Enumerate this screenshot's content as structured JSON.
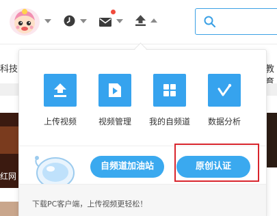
{
  "header": {
    "icons": [
      "avatar",
      "history-clock-icon",
      "mail-icon",
      "upload-icon",
      "search-icon"
    ],
    "accent": "#3aa0e5",
    "notification_color": "#f04a3c"
  },
  "background": {
    "nav_left_fragment": "科技",
    "nav_right_fragment": "教育",
    "thumb_caption_fragment": "红网"
  },
  "upload_menu": {
    "items": [
      {
        "label": "上传视频",
        "icon": "upload-icon"
      },
      {
        "label": "视频管理",
        "icon": "play-icon"
      },
      {
        "label": "我的自频道",
        "icon": "grid-icon"
      },
      {
        "label": "数据分析",
        "icon": "analytics-check-icon"
      }
    ],
    "promo_buttons": {
      "channel_boost": "自频道加油站",
      "original_cert": "原创认证"
    },
    "footer_text": "下载PC客户端，上传视频更轻松！",
    "tile_color": "#36a3ee",
    "highlight_color": "#d8242c"
  }
}
